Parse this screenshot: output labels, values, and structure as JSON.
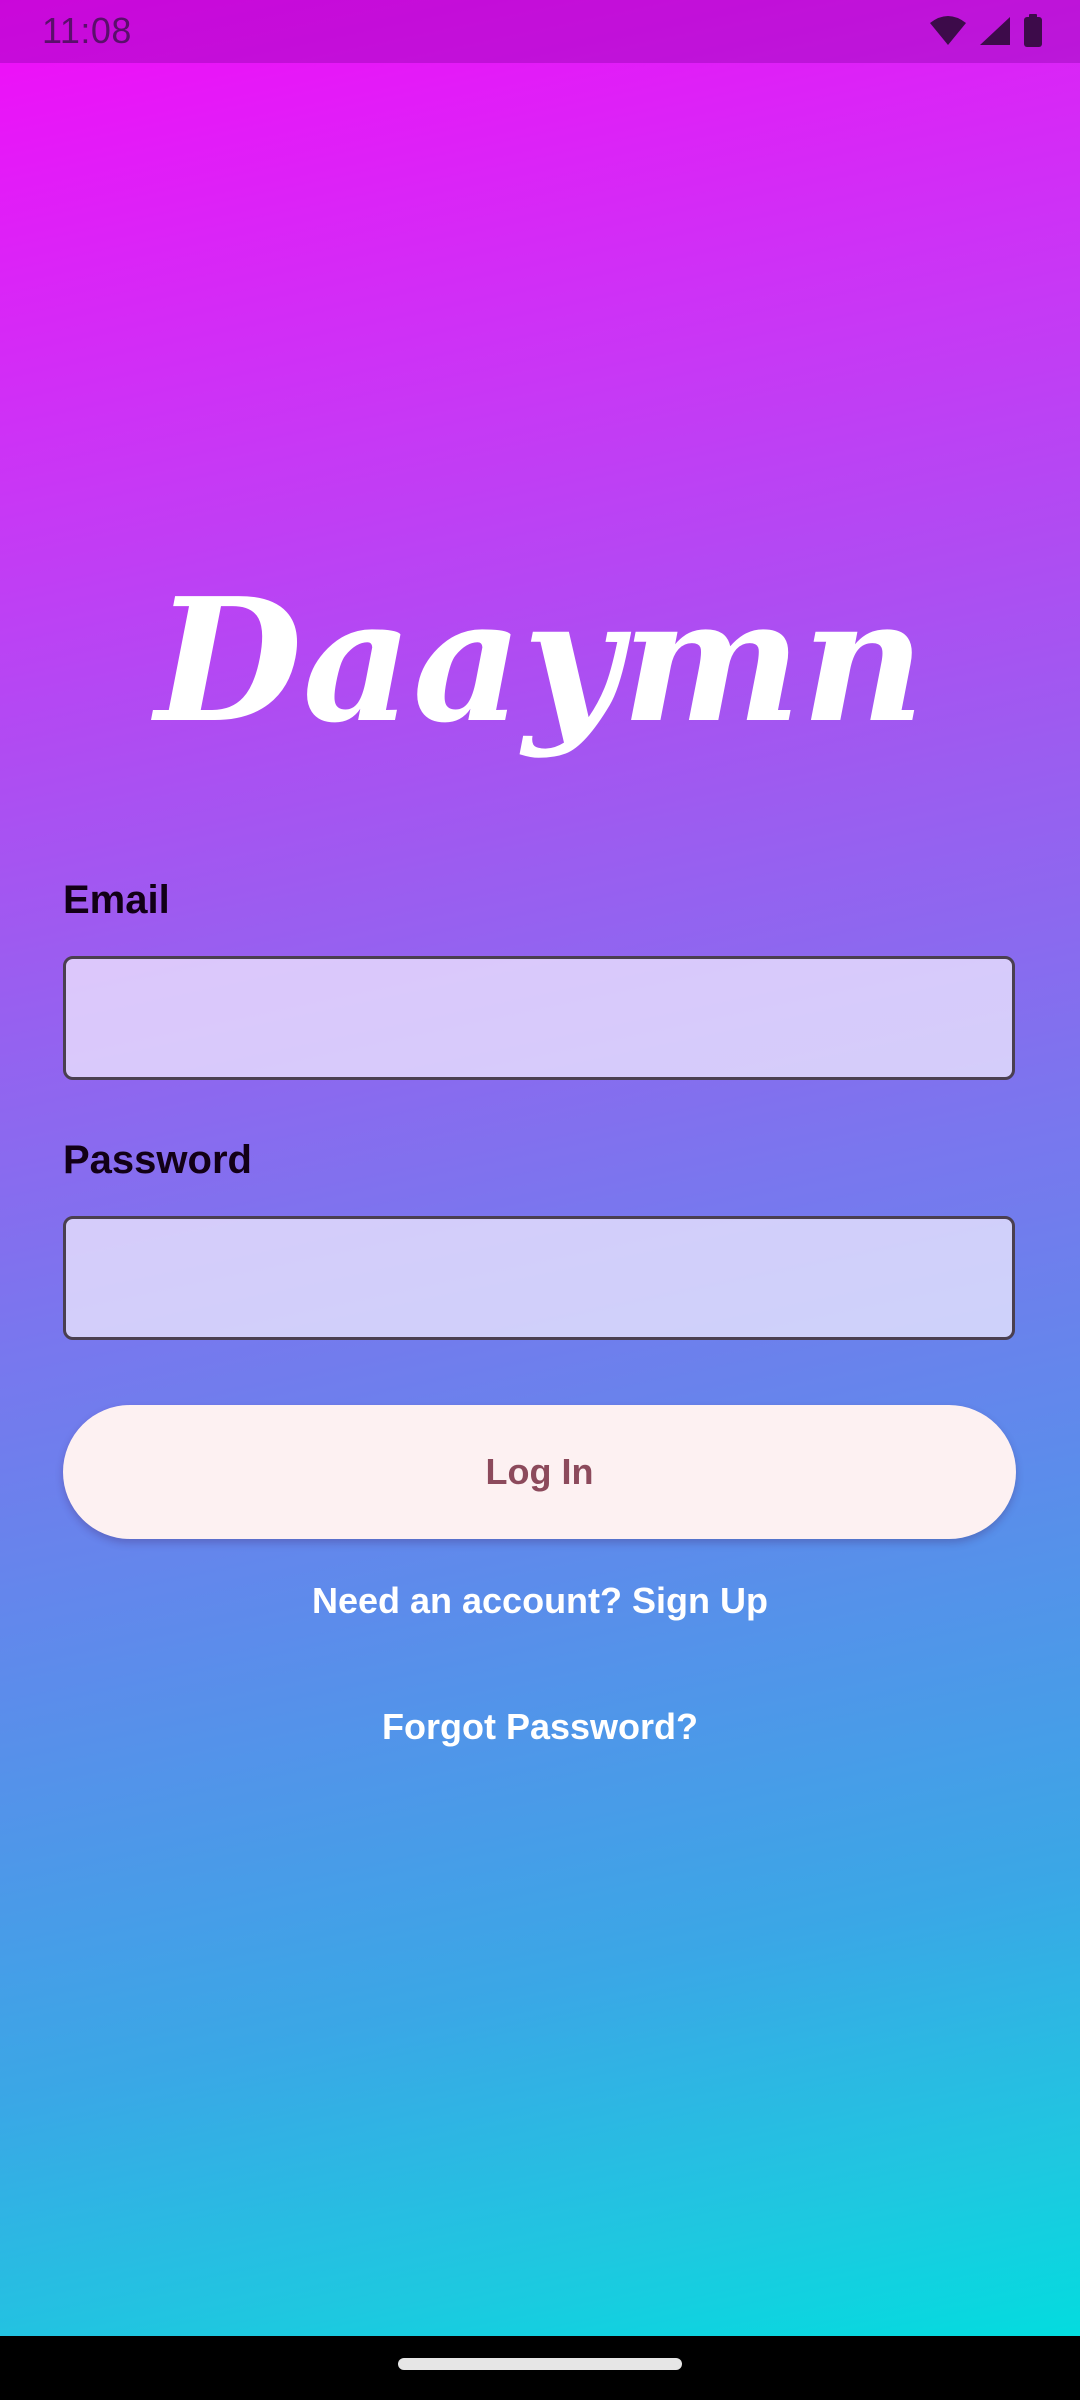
{
  "status_bar": {
    "time": "11:08",
    "icons": [
      "wifi-icon",
      "signal-icon",
      "battery-icon"
    ]
  },
  "app": {
    "logo_text": "Daaymn"
  },
  "form": {
    "email_label": "Email",
    "email_value": "",
    "email_placeholder": "",
    "password_label": "Password",
    "password_value": "",
    "password_placeholder": "",
    "login_label": "Log In"
  },
  "links": {
    "signup": "Need an account? Sign Up",
    "forgot": "Forgot Password?"
  },
  "colors": {
    "gradient_top": "#f20cf9",
    "gradient_bottom": "#03dcdf",
    "button_bg": "#fdf1f2",
    "button_text": "#8c4a5c",
    "label_text": "#120016",
    "link_text": "#ffffff"
  }
}
